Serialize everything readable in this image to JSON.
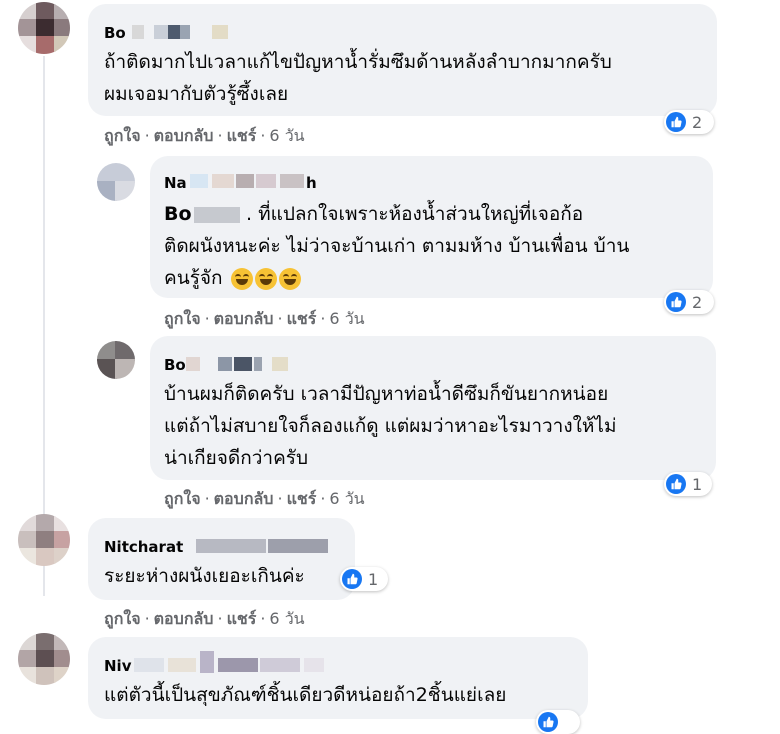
{
  "comments": [
    {
      "name": "Bo",
      "lines": [
        "ถ้าติดมากไปเวลาแก้ไขปัญหาน้ำรั่มซึมด้านหลังลำบากมากครับ",
        "ผมเจอมากับตัวรู้ซึ้งเลย"
      ],
      "like": "ถูกใจ",
      "reply": "ตอบกลับ",
      "share": "แชร์",
      "age": "6 วัน",
      "reactions": "2"
    },
    {
      "name": "Na",
      "name_tail": "h",
      "mention": "Bo",
      "lines": [
        ". ที่แปลกใจเพราะห้องน้ำส่วนใหญ่ที่เจอก้อ",
        "ติดผนังหนะค่ะ ไม่ว่าจะบ้านเก่า ตามมห้าง บ้านเพื่อน บ้าน",
        "คนรู้จัก"
      ],
      "like": "ถูกใจ",
      "reply": "ตอบกลับ",
      "share": "แชร์",
      "age": "6 วัน",
      "reactions": "2"
    },
    {
      "name": "Bo",
      "lines": [
        "บ้านผมก็ติดครับ เวลามีปัญหาท่อน้ำดีซึมก็ขันยากหน่อย",
        "แต่ถ้าไม่สบายใจก็ลองแก้ดู แต่ผมว่าหาอะไรมาวางให้ไม่",
        "น่าเกียจดีกว่าครับ"
      ],
      "like": "ถูกใจ",
      "reply": "ตอบกลับ",
      "share": "แชร์",
      "age": "6 วัน",
      "reactions": "1"
    },
    {
      "name": "Nitcharat",
      "lines": [
        "ระยะห่างผนังเยอะเกินค่ะ"
      ],
      "like": "ถูกใจ",
      "reply": "ตอบกลับ",
      "share": "แชร์",
      "age": "6 วัน",
      "reactions": "1"
    },
    {
      "name": "Niv",
      "lines": [
        "แต่ตัวนี้เป็นสุขภัณฑ์ชิ้นเดียวดีหน่อยถ้า2ชิ้นแย่เลย"
      ]
    }
  ],
  "colors": {
    "bubble": "#f0f2f5",
    "like_blue": "#1877f2",
    "meta_gray": "#65676b"
  },
  "icons": {
    "like": "thumbs-up-icon",
    "emoji": "grinning-sweat-emoji"
  }
}
